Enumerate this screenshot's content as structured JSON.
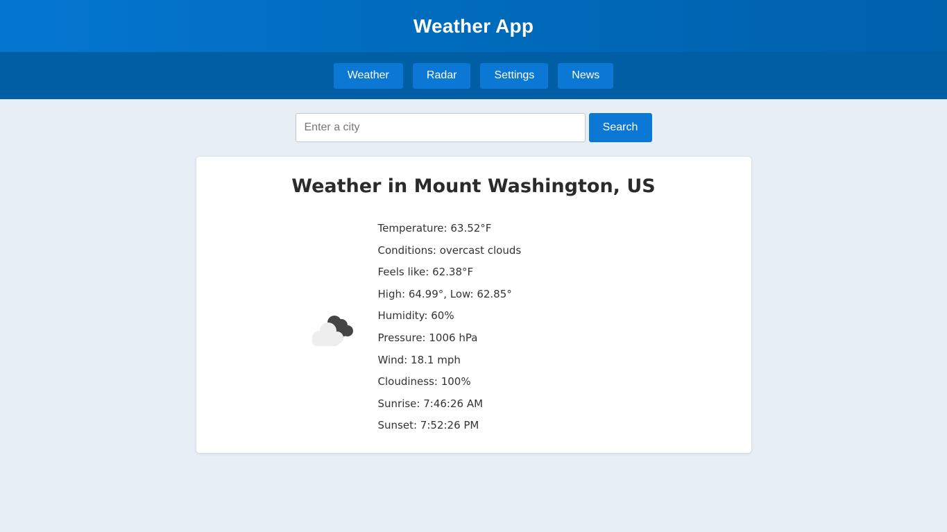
{
  "app": {
    "title": "Weather App"
  },
  "nav": {
    "items": [
      {
        "label": "Weather"
      },
      {
        "label": "Radar"
      },
      {
        "label": "Settings"
      },
      {
        "label": "News"
      }
    ]
  },
  "search": {
    "placeholder": "Enter a city",
    "value": "",
    "button_label": "Search"
  },
  "weather": {
    "heading": "Weather in Mount Washington, US",
    "icon": "overcast-clouds-icon",
    "details": [
      {
        "label": "Temperature:",
        "value": "63.52°F"
      },
      {
        "label": "Conditions:",
        "value": "overcast clouds"
      },
      {
        "label": "Feels like:",
        "value": "62.38°F"
      },
      {
        "label": "High:",
        "value": "64.99°, Low: 62.85°"
      },
      {
        "label": "Humidity:",
        "value": "60%"
      },
      {
        "label": "Pressure:",
        "value": "1006 hPa"
      },
      {
        "label": "Wind:",
        "value": "18.1 mph"
      },
      {
        "label": "Cloudiness:",
        "value": "100%"
      },
      {
        "label": "Sunrise:",
        "value": "7:46:26 AM"
      },
      {
        "label": "Sunset:",
        "value": "7:52:26 PM"
      }
    ]
  },
  "colors": {
    "header": "#0476d0",
    "nav_bar": "#005ea5",
    "button": "#0a78d4",
    "page_bg": "#e8eef5"
  }
}
